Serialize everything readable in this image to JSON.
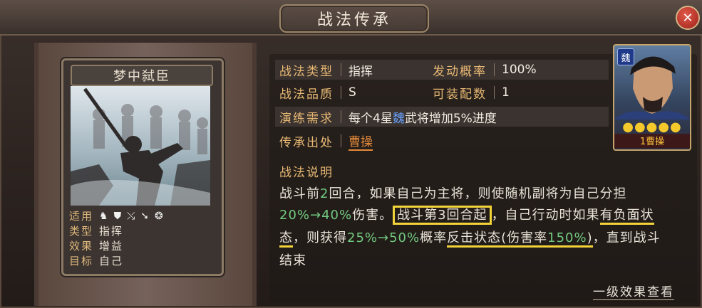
{
  "title": "战法传承",
  "close_icon": "close-icon",
  "card": {
    "name": "梦中弑臣",
    "meta": [
      {
        "key": "适用",
        "value": ""
      },
      {
        "key": "类型",
        "value": "指挥"
      },
      {
        "key": "效果",
        "value": "增益"
      },
      {
        "key": "目标",
        "value": "自己"
      }
    ],
    "usage_icons": [
      "cavalry-icon",
      "shield-icon",
      "archer-icon",
      "spear-icon",
      "wheel-icon"
    ]
  },
  "info": {
    "type_label": "战法类型",
    "type_value": "指挥",
    "prob_label": "发动概率",
    "prob_value": "100%",
    "quality_label": "战法品质",
    "quality_value": "S",
    "equip_label": "可装配数",
    "equip_value": "1",
    "req_label": "演练需求",
    "req_value_a": "每个4星",
    "req_value_faction": "魏",
    "req_value_b": "武将增加5%进度",
    "source_label": "传承出处",
    "source_value": "曹操"
  },
  "hero": {
    "faction": "魏",
    "stars": "●●●●●",
    "name": "1曹操",
    "accent_color": "#f4c92c"
  },
  "description": {
    "title": "战法说明",
    "l1a": "战斗前",
    "l1b": "2",
    "l1c": "回合，如果自己为主将，则使随机副将为自己分担",
    "l2a": "20%→40%",
    "l2b": "伤害。",
    "l2c": "战斗第3回合起",
    "l2d": "，自己行动时如果",
    "l2e": "有负面状",
    "l3a": "态",
    "l3b": "，则获得",
    "l3c": "25%→50%",
    "l3d": "概率",
    "l3e": "反击状态(伤害率",
    "l3f": "150%",
    "l3g": ")",
    "l3h": "，直到战斗",
    "l4": "结束"
  },
  "footer_link": "一级效果查看"
}
